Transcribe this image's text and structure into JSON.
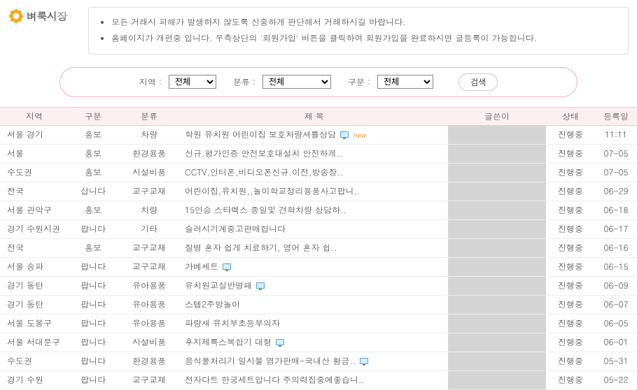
{
  "logo": {
    "text": "벼룩시장"
  },
  "notices": [
    "모든 거래시 피해가 발생하지 않도록 신중하게 판단해서 거래하시길 바랍니다.",
    "홈페이지가 개편중 입니다. 우측상단의 '회원가입' 버튼을 클릭하여 회원가입을 완료하시면 글등록이 가능합니다."
  ],
  "search": {
    "region_label": "지역 :",
    "region_value": "전체",
    "category_label": "분류 :",
    "category_value": "전체",
    "type_label": "구분 :",
    "type_value": "전체",
    "button": "검색"
  },
  "columns": {
    "region": "지역",
    "type": "구분",
    "category": "분류",
    "title": "제 목",
    "author": "글쓴이",
    "status": "상태",
    "date": "등록일"
  },
  "rows": [
    {
      "region": "서울 경기",
      "type": "홍보",
      "category": "차량",
      "title": "학원 유치원 어린이집 보호차량셔틀상담",
      "has_img": true,
      "is_new": true,
      "status": "진행중",
      "date": "11:11"
    },
    {
      "region": "서울",
      "type": "홍보",
      "category": "환경용품",
      "title": "신규.평가인증 안전보호대설치 안전하게..",
      "has_img": false,
      "is_new": false,
      "status": "진행중",
      "date": "07-05"
    },
    {
      "region": "수도권",
      "type": "홍보",
      "category": "시설비품",
      "title": "CCTV,인터폰,비디오폰신규.이전,방송장..",
      "has_img": false,
      "is_new": false,
      "status": "진행중",
      "date": "07-05"
    },
    {
      "region": "전국",
      "type": "삽니다",
      "category": "교구교재",
      "title": "어린이집,유치원,,놀이학교정리용품사고팝니..",
      "has_img": false,
      "is_new": false,
      "status": "진행중",
      "date": "06-29"
    },
    {
      "region": "서울 관악구",
      "type": "홍보",
      "category": "차량",
      "title": "15인승 스타렉스 종일및 견학차량 상담하..",
      "has_img": false,
      "is_new": false,
      "status": "진행중",
      "date": "06-18"
    },
    {
      "region": "경기 수원시권",
      "type": "팝니다",
      "category": "기타",
      "title": "슬러시기계중고판매합니다",
      "has_img": false,
      "is_new": false,
      "status": "진행중",
      "date": "06-17"
    },
    {
      "region": "전국",
      "type": "홍보",
      "category": "교구교재",
      "title": "질병 혼자 쉽게 치료하기, 영어 혼자 쉽..",
      "has_img": false,
      "is_new": false,
      "status": "진행중",
      "date": "06-16"
    },
    {
      "region": "서울 송파",
      "type": "팝니다",
      "category": "교구교재",
      "title": "가베세트",
      "has_img": true,
      "is_new": false,
      "status": "진행중",
      "date": "06-15"
    },
    {
      "region": "경기 동탄",
      "type": "팝니다",
      "category": "유아용품",
      "title": "유치원교실반명패",
      "has_img": true,
      "is_new": false,
      "status": "진행중",
      "date": "06-09"
    },
    {
      "region": "경기 동탄",
      "type": "팝니다",
      "category": "유아용품",
      "title": "스텝2주방놀이",
      "has_img": false,
      "is_new": false,
      "status": "진행중",
      "date": "06-07"
    },
    {
      "region": "서울 도봉구",
      "type": "팝니다",
      "category": "유아용품",
      "title": "파랑새 유치부초등부의자",
      "has_img": false,
      "is_new": false,
      "status": "진행중",
      "date": "06-05"
    },
    {
      "region": "서울 서대문구",
      "type": "팝니다",
      "category": "시설비품",
      "title": "후지제록스복합기 대형",
      "has_img": true,
      "is_new": false,
      "status": "진행중",
      "date": "06-01"
    },
    {
      "region": "수도권",
      "type": "팝니다",
      "category": "환경용품",
      "title": "음식물처리기 일시불 염가판매-국내산 황금..",
      "has_img": true,
      "is_new": false,
      "status": "진행중",
      "date": "05-31"
    },
    {
      "region": "경기 수원",
      "type": "팝니다",
      "category": "교구교재",
      "title": "전자다트 한궁세트입니다 주의력집중에좋습니..",
      "has_img": false,
      "is_new": false,
      "status": "진행중",
      "date": "05-22"
    }
  ]
}
